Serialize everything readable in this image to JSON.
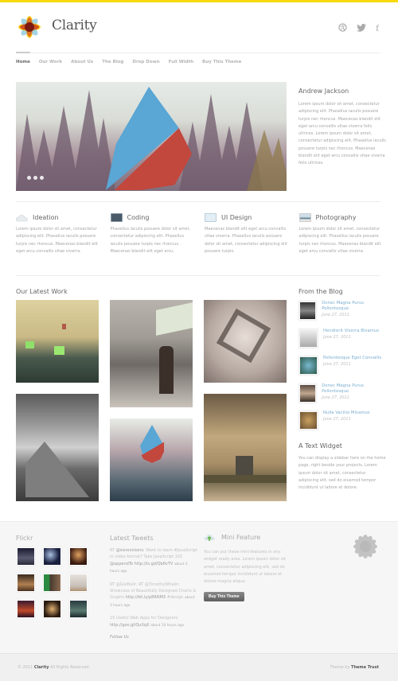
{
  "colors": {
    "accent_bar": "#f7d90e",
    "link_blue": "#7aaed0",
    "text_dark": "#666666",
    "text_light": "#a5a5a5"
  },
  "header": {
    "site_title": "Clarity",
    "social": [
      {
        "name": "dribbble",
        "glyph": "⊛"
      },
      {
        "name": "twitter",
        "glyph": "🐦"
      },
      {
        "name": "facebook",
        "glyph": "f"
      }
    ]
  },
  "nav": {
    "items": [
      {
        "label": "Home",
        "active": true
      },
      {
        "label": "Our Work"
      },
      {
        "label": "About Us"
      },
      {
        "label": "The Blog"
      },
      {
        "label": "Drop Down"
      },
      {
        "label": "Full Width"
      },
      {
        "label": "Buy This Theme"
      }
    ]
  },
  "hero": {
    "slide_count": 3,
    "sidebar": {
      "title": "Andrew Jackson",
      "text": "Lorem ipsum dolor sit amet, consectetur adipiscing elit. Phasellus iaculis posuere turpis nec rhoncus. Maecenas blandit elit eget arcu convallis vitae viverra felis ultrices. Lorem ipsum dolor sit amet, consectetur adipiscing elit. Phasellus iaculis posuere turpis nec rhoncus. Maecenas blandit elit eget arcu convallis vitae viverra felis ultrices."
    }
  },
  "features": [
    {
      "icon": "cloud-icon",
      "title": "Ideation",
      "text": "Lorem ipsum dolor sit amet, consectetur adipiscing elit. Phasellus iaculis posuere turpis nec rhoncus. Maecenas blandit elit eget arcu convallis vitae viverra."
    },
    {
      "icon": "terminal-icon",
      "title": "Coding",
      "text": "Phasellus iaculis posuere dolor sit amet, consectetur adipiscing elit. Phasellus iaculis posuere turpis nec rhoncus. Maecenas blandit elit eget arcu."
    },
    {
      "icon": "window-icon",
      "title": "UI Design",
      "text": "Maecenas blandit elit eget arcu convallis vitae viverra. Phasellus iaculis posuere dolor sit amet, consectetur adipiscing elit posuere turpis."
    },
    {
      "icon": "photo-icon",
      "title": "Photography",
      "text": "Lorem ipsum dolor sit amet, consectetur adipiscing elit. Phasellus iaculis posuere turpis nec rhoncus. Maecenas blandit elit eget arcu convallis vitae viverra."
    }
  ],
  "latest_work": {
    "title": "Our Latest Work",
    "items": [
      {
        "subject": "gallery-room"
      },
      {
        "subject": "city-street-man"
      },
      {
        "subject": "paper-sculpture"
      },
      {
        "subject": "church-bw"
      },
      {
        "subject": "andrew-jackson-poster"
      },
      {
        "subject": "castle-sunrays"
      }
    ]
  },
  "blog": {
    "title": "From the Blog",
    "posts": [
      {
        "title": "Donec Magna Purus Pellentesque",
        "date": "June 27, 2011"
      },
      {
        "title": "Hendrerit Viverra Bivamus",
        "date": "June 27, 2011"
      },
      {
        "title": "Pellentesque Eget Convallis",
        "date": "June 27, 2011"
      },
      {
        "title": "Donec Magna Purus Pellentesque",
        "date": "June 27, 2011"
      },
      {
        "title": "Nulla Vacilisi Mivamus",
        "date": "June 27, 2011"
      }
    ]
  },
  "text_widget": {
    "title": "A Text Widget",
    "text": "You can display a sidebar here on the home page, right beside your projects. Lorem ipsum dolor sit amet, consectetur adipiscing elit, sed do eiusmod tempor incididunt ut labore et dolore."
  },
  "footer": {
    "flickr": {
      "title": "Flickr",
      "photo_count": 9
    },
    "tweets": {
      "title": "Latest Tweets",
      "items": [
        {
          "pre": "RT ",
          "user": "@sixrevisions:",
          "text": " Want to learn #JavaScript in video format? Take JavaScript 101 ",
          "link": "@appendTo http://is.gd/Qb8vTV",
          "time": "about 3 hours ago"
        },
        {
          "pre": "RT ",
          "user": "@GisMullr:",
          "text": " RT @TimothyWhalin: Showcase of Beautifully Designed Charts & Graphs ",
          "link": "http://bit.ly/p8RNM3",
          "tag": " #design",
          "time": "about 3 hours ago"
        },
        {
          "pre": "",
          "user": "",
          "text": "15 Useful Web Apps for Designers ",
          "link": "http://goo.gl/QuXqX",
          "time": "about 10 hours ago"
        }
      ],
      "follow": "Follow Us"
    },
    "mini_feature": {
      "title": "Mini Feature",
      "text": "You can put these mini-features in any widget ready area. Lorem ipsum dolor sit amet, consectetur adipiscing elit, sed do eiusmod tempor incididunt ut labore et dolore magna aliqua.",
      "button": "Buy This Theme"
    },
    "copyright_pre": "© 2011 ",
    "copyright_brand": "Clarity",
    "copyright_post": " All Rights Reserved.",
    "credit_pre": "Theme by ",
    "credit_brand": "Theme Trust"
  }
}
